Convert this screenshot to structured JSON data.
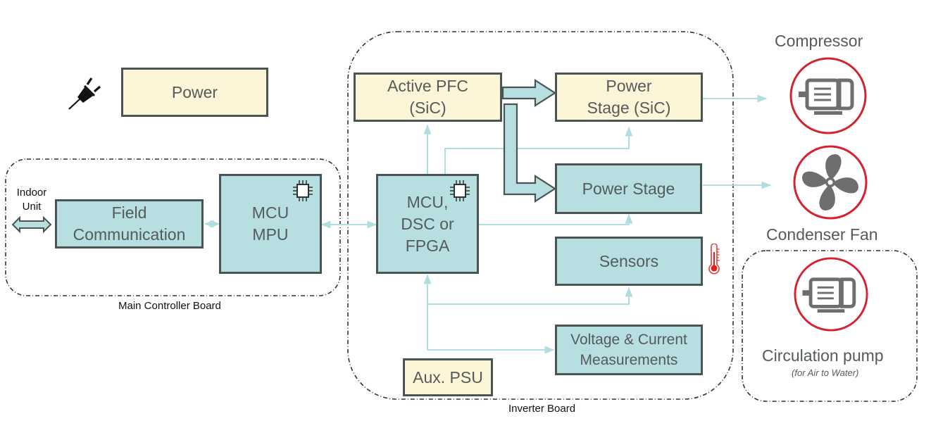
{
  "power_source": {
    "icon": "plug-icon",
    "label": "Power"
  },
  "main_controller_board": {
    "label": "Main Controller Board",
    "indoor_unit_label": "Indoor\nUnit",
    "field_communication": "Field\nCommunication",
    "mcu_mpu": "MCU\nMPU",
    "chip_icon": "chip-icon"
  },
  "inverter_board": {
    "label": "Inverter Board",
    "active_pfc": "Active PFC\n(SiC)",
    "power_stage_sic": "Power\nStage (SiC)",
    "mcu_dsc_fpga": "MCU,\nDSC or\nFPGA",
    "power_stage": "Power Stage",
    "sensors": "Sensors",
    "sensor_icon": "thermometer-icon",
    "voltage_current": "Voltage & Current\nMeasurements",
    "aux_psu": "Aux. PSU"
  },
  "loads": {
    "compressor": {
      "label": "Compressor",
      "icon": "motor-icon"
    },
    "condenser_fan": {
      "label": "Condenser Fan",
      "icon": "fan-icon"
    },
    "circulation_pump": {
      "label": "Circulation pump",
      "note": "(for Air to Water)",
      "icon": "motor-icon"
    }
  },
  "colors": {
    "power_block": "#fdf5d8",
    "control_block": "#b7dfe2",
    "border": "#4a5453",
    "signal_line": "#b0dde0",
    "load_ring": "#d8202e",
    "icon_gray": "#6e6e70"
  }
}
